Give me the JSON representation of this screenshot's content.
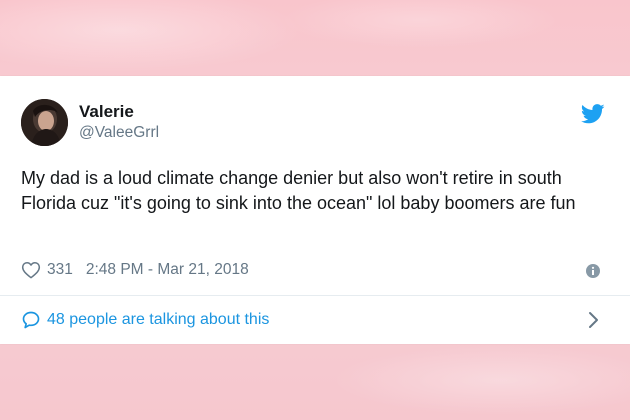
{
  "tweet": {
    "author_name": "Valerie",
    "author_handle": "@ValeeGrrl",
    "text": "My dad is a loud climate change denier but also won't retire in south Florida cuz \"it's going to sink into the ocean\" lol baby boomers are fun",
    "like_count": "331",
    "timestamp": "2:48 PM - Mar 21, 2018",
    "conversation_link": "48 people are talking about this"
  },
  "icons": {
    "brand": "twitter-bird-icon",
    "like": "heart-icon",
    "info": "info-icon",
    "conversation": "speech-bubble-icon",
    "chevron": "chevron-right-icon"
  },
  "colors": {
    "background": "#f8c9cf",
    "card": "#ffffff",
    "twitter_blue": "#1da1f2",
    "link_blue": "#1b95e0",
    "text_primary": "#14171a",
    "text_secondary": "#657786"
  }
}
